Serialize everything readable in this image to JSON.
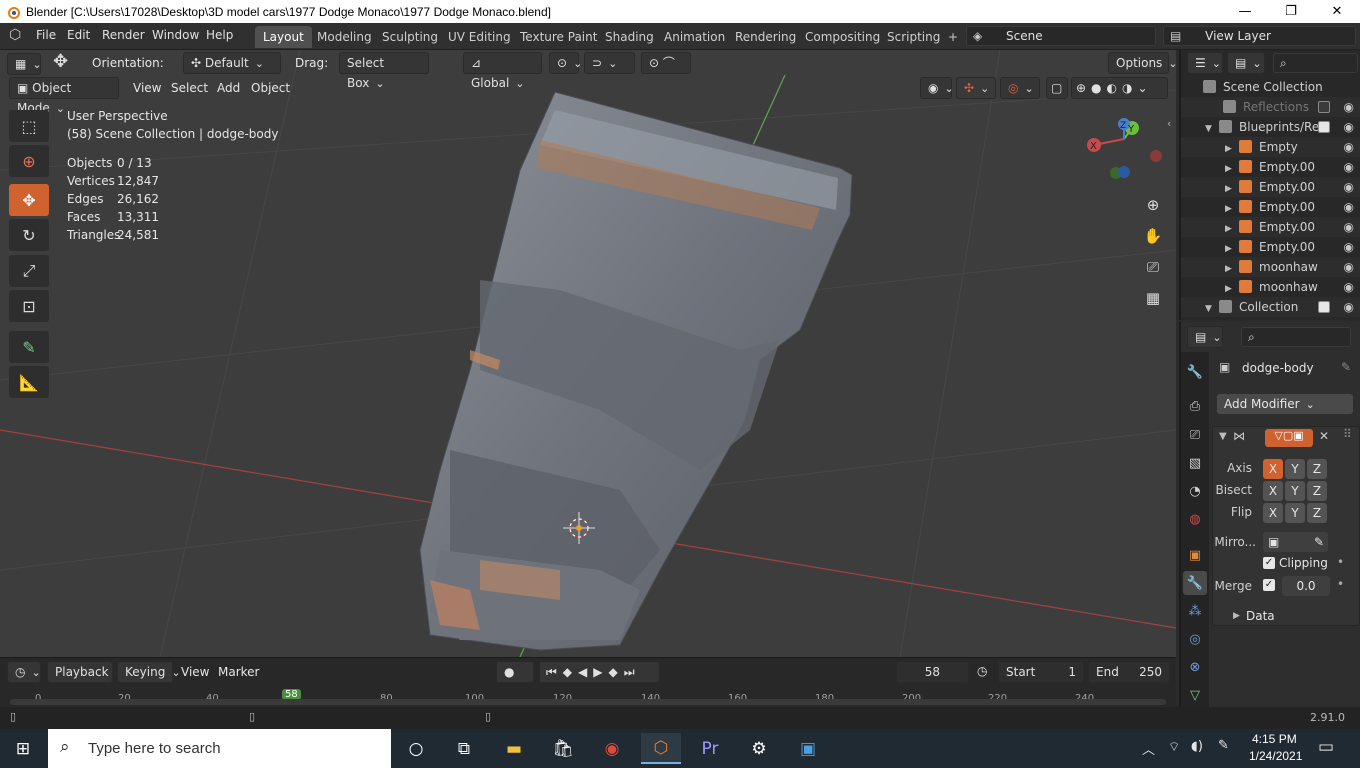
{
  "titlebar": {
    "title": "Blender [C:\\Users\\17028\\Desktop\\3D model cars\\1977 Dodge Monaco\\1977 Dodge Monaco.blend]",
    "minimize": "—",
    "maximize": "❐",
    "close": "✕"
  },
  "menu": {
    "file": "File",
    "edit": "Edit",
    "render": "Render",
    "window": "Window",
    "help": "Help"
  },
  "workspaces": [
    "Layout",
    "Modeling",
    "Sculpting",
    "UV Editing",
    "Texture Paint",
    "Shading",
    "Animation",
    "Rendering",
    "Compositing",
    "Scripting"
  ],
  "workspace_add": "+",
  "scene": {
    "label": "Scene",
    "view_layer": "View Layer"
  },
  "tool_header": {
    "orientation_label": "Orientation:",
    "orientation_value": "Default",
    "drag_label": "Drag:",
    "drag_value": "Select Box",
    "transform": "Global",
    "options": "Options"
  },
  "view_header": {
    "mode": "Object Mode",
    "view": "View",
    "select": "Select",
    "add": "Add",
    "object": "Object"
  },
  "viewport_info": {
    "perspective": "User Perspective",
    "collection": "(58) Scene Collection | dodge-body"
  },
  "stats": [
    {
      "key": "Objects",
      "value": "0 / 13"
    },
    {
      "key": "Vertices",
      "value": "12,847"
    },
    {
      "key": "Edges",
      "value": "26,162"
    },
    {
      "key": "Faces",
      "value": "13,311"
    },
    {
      "key": "Triangles",
      "value": "24,581"
    }
  ],
  "gizmo": {
    "x": "X",
    "y": "Y",
    "z": "Z"
  },
  "outliner": {
    "root": "Scene Collection",
    "rows": [
      {
        "label": "Reflections",
        "dim": true
      },
      {
        "label": "Blueprints/Ref"
      },
      {
        "label": "Empty"
      },
      {
        "label": "Empty.00"
      },
      {
        "label": "Empty.00"
      },
      {
        "label": "Empty.00"
      },
      {
        "label": "Empty.00"
      },
      {
        "label": "Empty.00"
      },
      {
        "label": "moonhaw"
      },
      {
        "label": "moonhaw"
      },
      {
        "label": "Collection"
      }
    ]
  },
  "properties": {
    "object_name": "dodge-body",
    "add_modifier": "Add Modifier",
    "axis_label": "Axis",
    "bisect_label": "Bisect",
    "flip_label": "Flip",
    "x": "X",
    "y": "Y",
    "z": "Z",
    "mirror_label": "Mirro...",
    "clipping": "Clipping",
    "merge_label": "Merge",
    "merge_value": "0.0",
    "data_label": "Data"
  },
  "timeline": {
    "playback": "Playback",
    "keying": "Keying",
    "view": "View",
    "marker": "Marker",
    "current_frame": "58",
    "start_label": "Start",
    "start": "1",
    "end_label": "End",
    "end": "250",
    "ticks": [
      "0",
      "20",
      "40",
      "58",
      "80",
      "100",
      "120",
      "140",
      "160",
      "180",
      "200",
      "220",
      "240"
    ]
  },
  "status": {
    "version": "2.91.0"
  },
  "taskbar": {
    "search_placeholder": "Type here to search",
    "time": "4:15 PM",
    "date": "1/24/2021"
  },
  "colors": {
    "accent": "#d0622f",
    "workspace_active": "#505050",
    "x_axis": "#c84a4a",
    "y_axis": "#6bbf3a",
    "z_axis": "#4a7fd0"
  }
}
